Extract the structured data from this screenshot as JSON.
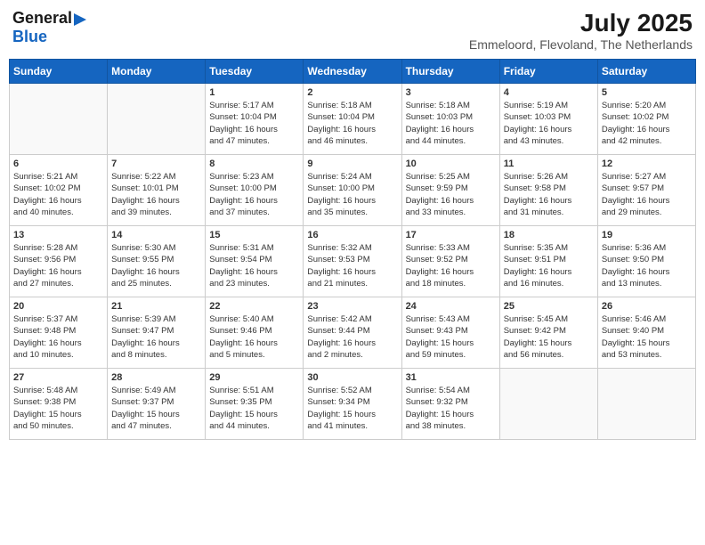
{
  "header": {
    "logo_general": "General",
    "logo_blue": "Blue",
    "month_year": "July 2025",
    "location": "Emmeloord, Flevoland, The Netherlands"
  },
  "weekdays": [
    "Sunday",
    "Monday",
    "Tuesday",
    "Wednesday",
    "Thursday",
    "Friday",
    "Saturday"
  ],
  "weeks": [
    [
      {
        "day": "",
        "info": ""
      },
      {
        "day": "",
        "info": ""
      },
      {
        "day": "1",
        "info": "Sunrise: 5:17 AM\nSunset: 10:04 PM\nDaylight: 16 hours\nand 47 minutes."
      },
      {
        "day": "2",
        "info": "Sunrise: 5:18 AM\nSunset: 10:04 PM\nDaylight: 16 hours\nand 46 minutes."
      },
      {
        "day": "3",
        "info": "Sunrise: 5:18 AM\nSunset: 10:03 PM\nDaylight: 16 hours\nand 44 minutes."
      },
      {
        "day": "4",
        "info": "Sunrise: 5:19 AM\nSunset: 10:03 PM\nDaylight: 16 hours\nand 43 minutes."
      },
      {
        "day": "5",
        "info": "Sunrise: 5:20 AM\nSunset: 10:02 PM\nDaylight: 16 hours\nand 42 minutes."
      }
    ],
    [
      {
        "day": "6",
        "info": "Sunrise: 5:21 AM\nSunset: 10:02 PM\nDaylight: 16 hours\nand 40 minutes."
      },
      {
        "day": "7",
        "info": "Sunrise: 5:22 AM\nSunset: 10:01 PM\nDaylight: 16 hours\nand 39 minutes."
      },
      {
        "day": "8",
        "info": "Sunrise: 5:23 AM\nSunset: 10:00 PM\nDaylight: 16 hours\nand 37 minutes."
      },
      {
        "day": "9",
        "info": "Sunrise: 5:24 AM\nSunset: 10:00 PM\nDaylight: 16 hours\nand 35 minutes."
      },
      {
        "day": "10",
        "info": "Sunrise: 5:25 AM\nSunset: 9:59 PM\nDaylight: 16 hours\nand 33 minutes."
      },
      {
        "day": "11",
        "info": "Sunrise: 5:26 AM\nSunset: 9:58 PM\nDaylight: 16 hours\nand 31 minutes."
      },
      {
        "day": "12",
        "info": "Sunrise: 5:27 AM\nSunset: 9:57 PM\nDaylight: 16 hours\nand 29 minutes."
      }
    ],
    [
      {
        "day": "13",
        "info": "Sunrise: 5:28 AM\nSunset: 9:56 PM\nDaylight: 16 hours\nand 27 minutes."
      },
      {
        "day": "14",
        "info": "Sunrise: 5:30 AM\nSunset: 9:55 PM\nDaylight: 16 hours\nand 25 minutes."
      },
      {
        "day": "15",
        "info": "Sunrise: 5:31 AM\nSunset: 9:54 PM\nDaylight: 16 hours\nand 23 minutes."
      },
      {
        "day": "16",
        "info": "Sunrise: 5:32 AM\nSunset: 9:53 PM\nDaylight: 16 hours\nand 21 minutes."
      },
      {
        "day": "17",
        "info": "Sunrise: 5:33 AM\nSunset: 9:52 PM\nDaylight: 16 hours\nand 18 minutes."
      },
      {
        "day": "18",
        "info": "Sunrise: 5:35 AM\nSunset: 9:51 PM\nDaylight: 16 hours\nand 16 minutes."
      },
      {
        "day": "19",
        "info": "Sunrise: 5:36 AM\nSunset: 9:50 PM\nDaylight: 16 hours\nand 13 minutes."
      }
    ],
    [
      {
        "day": "20",
        "info": "Sunrise: 5:37 AM\nSunset: 9:48 PM\nDaylight: 16 hours\nand 10 minutes."
      },
      {
        "day": "21",
        "info": "Sunrise: 5:39 AM\nSunset: 9:47 PM\nDaylight: 16 hours\nand 8 minutes."
      },
      {
        "day": "22",
        "info": "Sunrise: 5:40 AM\nSunset: 9:46 PM\nDaylight: 16 hours\nand 5 minutes."
      },
      {
        "day": "23",
        "info": "Sunrise: 5:42 AM\nSunset: 9:44 PM\nDaylight: 16 hours\nand 2 minutes."
      },
      {
        "day": "24",
        "info": "Sunrise: 5:43 AM\nSunset: 9:43 PM\nDaylight: 15 hours\nand 59 minutes."
      },
      {
        "day": "25",
        "info": "Sunrise: 5:45 AM\nSunset: 9:42 PM\nDaylight: 15 hours\nand 56 minutes."
      },
      {
        "day": "26",
        "info": "Sunrise: 5:46 AM\nSunset: 9:40 PM\nDaylight: 15 hours\nand 53 minutes."
      }
    ],
    [
      {
        "day": "27",
        "info": "Sunrise: 5:48 AM\nSunset: 9:38 PM\nDaylight: 15 hours\nand 50 minutes."
      },
      {
        "day": "28",
        "info": "Sunrise: 5:49 AM\nSunset: 9:37 PM\nDaylight: 15 hours\nand 47 minutes."
      },
      {
        "day": "29",
        "info": "Sunrise: 5:51 AM\nSunset: 9:35 PM\nDaylight: 15 hours\nand 44 minutes."
      },
      {
        "day": "30",
        "info": "Sunrise: 5:52 AM\nSunset: 9:34 PM\nDaylight: 15 hours\nand 41 minutes."
      },
      {
        "day": "31",
        "info": "Sunrise: 5:54 AM\nSunset: 9:32 PM\nDaylight: 15 hours\nand 38 minutes."
      },
      {
        "day": "",
        "info": ""
      },
      {
        "day": "",
        "info": ""
      }
    ]
  ]
}
